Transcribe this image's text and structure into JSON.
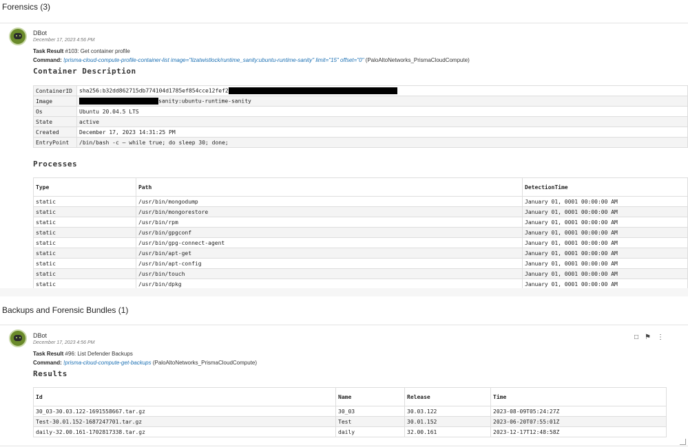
{
  "forensics": {
    "title": "Forensics (3)",
    "entry": {
      "author": "DBot",
      "date": "December 17, 2023 4:56 PM",
      "task_label": "Task Result",
      "task_text": "#103: Get container profile",
      "command_label": "Command:",
      "command": "!prisma-cloud-compute-profile-container-list image=\"lizatwistlock/runtime_sanity:ubuntu-runtime-sanity\" limit=\"15\" offset=\"0\"",
      "integration": "(PaloAltoNetworks_PrismaCloudCompute)"
    },
    "container_heading": "Container Description",
    "container": [
      {
        "key": "ContainerID",
        "value": "sha256:b32dd862715db774104d1785ef854cce12fef2"
      },
      {
        "key": "Image",
        "value": "sanity:ubuntu-runtime-sanity"
      },
      {
        "key": "Os",
        "value": "Ubuntu 20.04.5 LTS"
      },
      {
        "key": "State",
        "value": "active"
      },
      {
        "key": "Created",
        "value": "December 17, 2023 14:31:25 PM"
      },
      {
        "key": "EntryPoint",
        "value": "/bin/bash -c — while true; do sleep 30; done;"
      }
    ],
    "processes_heading": "Processes",
    "process_headers": [
      "Type",
      "Path",
      "DetectionTime"
    ],
    "processes": [
      [
        "static",
        "/usr/bin/mongodump",
        "January 01, 0001 00:00:00 AM"
      ],
      [
        "static",
        "/usr/bin/mongorestore",
        "January 01, 0001 00:00:00 AM"
      ],
      [
        "static",
        "/usr/bin/rpm",
        "January 01, 0001 00:00:00 AM"
      ],
      [
        "static",
        "/usr/bin/gpgconf",
        "January 01, 0001 00:00:00 AM"
      ],
      [
        "static",
        "/usr/bin/gpg-connect-agent",
        "January 01, 0001 00:00:00 AM"
      ],
      [
        "static",
        "/usr/bin/apt-get",
        "January 01, 0001 00:00:00 AM"
      ],
      [
        "static",
        "/usr/bin/apt-config",
        "January 01, 0001 00:00:00 AM"
      ],
      [
        "static",
        "/usr/bin/touch",
        "January 01, 0001 00:00:00 AM"
      ],
      [
        "static",
        "/usr/bin/dpkg",
        "January 01, 0001 00:00:00 AM"
      ]
    ]
  },
  "backups": {
    "title": "Backups and Forensic Bundles (1)",
    "entry": {
      "author": "DBot",
      "date": "December 17, 2023 4:56 PM",
      "task_label": "Task Result",
      "task_text": "#96: List Defender Backups",
      "command_label": "Command:",
      "command": "!prisma-cloud-compute-get-backups",
      "integration": "(PaloAltoNetworks_PrismaCloudCompute)"
    },
    "results_heading": "Results",
    "result_headers": [
      "Id",
      "Name",
      "Release",
      "Time"
    ],
    "results": [
      [
        "30_03-30.03.122-1691558667.tar.gz",
        "30_03",
        "30.03.122",
        "2023-08-09T05:24:27Z"
      ],
      [
        "Test-30.01.152-1687247701.tar.gz",
        "Test",
        "30.01.152",
        "2023-06-20T07:55:01Z"
      ],
      [
        "daily-32.00.161-1702817338.tar.gz",
        "daily",
        "32.00.161",
        "2023-12-17T12:48:58Z"
      ]
    ],
    "tool_icons": [
      "note-icon",
      "flag-icon",
      "more-icon"
    ]
  }
}
